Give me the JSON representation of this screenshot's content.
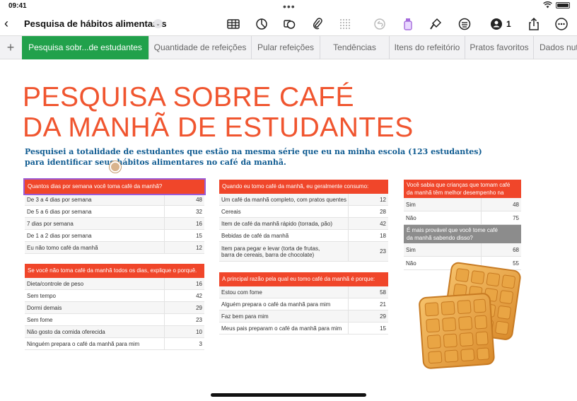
{
  "status": {
    "time": "09:41"
  },
  "toolbar": {
    "title": "Pesquisa de hábitos alimentares",
    "collaborators": "1"
  },
  "tabs": [
    {
      "label": "Pesquisa sobr...de estudantes"
    },
    {
      "label": "Quantidade de refeições"
    },
    {
      "label": "Pular refeições"
    },
    {
      "label": "Tendências"
    },
    {
      "label": "Itens do refeitório"
    },
    {
      "label": "Pratos favoritos"
    },
    {
      "label": "Dados nut"
    }
  ],
  "sheet": {
    "heading_line1": "PESQUISA SOBRE CAFÉ",
    "heading_line2": "DA MANHÃ DE ESTUDANTES",
    "intro_line1": "Pesquisei a totalidade de estudantes que estão na mesma série que eu na minha escola (123 estudantes)",
    "intro_line2": "para identificar seus hábitos alimentares no café da manhã."
  },
  "tables": {
    "t1": {
      "header": "Quantos dias por semana você toma café da manhã?",
      "rows": [
        [
          "De 3 a 4 dias por semana",
          "48"
        ],
        [
          "De 5 a 6 dias por semana",
          "32"
        ],
        [
          "7 dias por semana",
          "16"
        ],
        [
          "De 1 a 2 dias por semana",
          "15"
        ],
        [
          "Eu não tomo café da manhã",
          "12"
        ]
      ]
    },
    "t2": {
      "header": "Se você não toma café da manhã todos os dias, explique o porquê.",
      "rows": [
        [
          "Dieta/controle de peso",
          "16"
        ],
        [
          "Sem tempo",
          "42"
        ],
        [
          "Dormi demais",
          "29"
        ],
        [
          "Sem fome",
          "23"
        ],
        [
          "Não gosto da comida oferecida",
          "10"
        ],
        [
          "Ninguém prepara o café da manhã para mim",
          "3"
        ]
      ]
    },
    "t3": {
      "header": "Quando eu tomo café da manhã, eu geralmente consumo:",
      "rows": [
        [
          "Um café da manhã completo, com pratos quentes",
          "12"
        ],
        [
          "Cereais",
          "28"
        ],
        [
          "Item de café da manhã rápido (torrada, pão)",
          "42"
        ],
        [
          "Bebidas de café da manhã",
          "18"
        ],
        [
          "Item para pegar e levar (torta de frutas,",
          "23"
        ]
      ],
      "row5_line2": "barra de cereais, barra de chocolate)"
    },
    "t4": {
      "header": "A principal razão pela qual eu tomo café da manhã é porque:",
      "rows": [
        [
          "Estou com fome",
          "58"
        ],
        [
          "Alguém prepara o café da manhã para mim",
          "21"
        ],
        [
          "Faz bem para mim",
          "29"
        ],
        [
          "Meus pais preparam o café da manhã para mim",
          "15"
        ]
      ]
    },
    "t5": {
      "header_line1": "Você sabia que crianças que tomam café",
      "header_line2": "da manhã têm melhor desempenho na escola?",
      "rows": [
        [
          "Sim",
          "48"
        ],
        [
          "Não",
          "75"
        ]
      ]
    },
    "t6": {
      "header_line1": "É mais provável que você tome café",
      "header_line2": "da manhã sabendo disso?",
      "rows": [
        [
          "Sim",
          "68"
        ],
        [
          "Não",
          "55"
        ]
      ]
    }
  }
}
